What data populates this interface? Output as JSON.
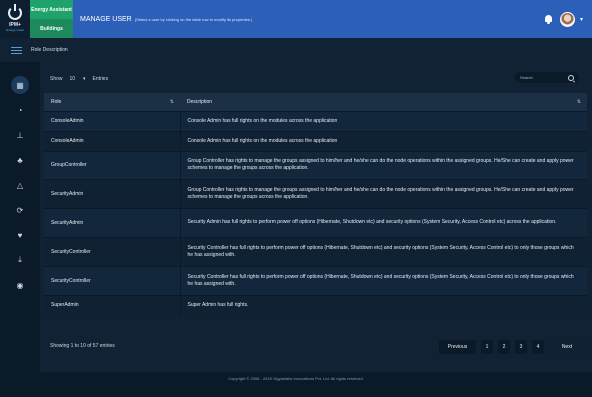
{
  "header": {
    "logo_text": "IPM+",
    "logo_tagline": "Energy smart",
    "app_energy": "Energy Assistant",
    "app_buildings": "Buildings",
    "title": "MANAGE USER",
    "hint": "(Select a user by clicking on the table row to modify its properties.)"
  },
  "subbar": {
    "breadcrumb": "Role Description"
  },
  "sidebar": {
    "items": [
      {
        "icon": "dashboard-icon",
        "active": true
      },
      {
        "icon": "pie-chart-icon"
      },
      {
        "icon": "hierarchy-icon"
      },
      {
        "icon": "devices-icon"
      },
      {
        "icon": "network-icon"
      },
      {
        "icon": "refresh-icon"
      },
      {
        "icon": "heartbeat-icon"
      },
      {
        "icon": "download-icon"
      },
      {
        "icon": "user-icon"
      }
    ]
  },
  "table_controls": {
    "show_label": "Show",
    "page_size": "10",
    "entries_label": "Entries",
    "search_placeholder": "Search"
  },
  "table": {
    "columns": [
      "Role",
      "Description"
    ],
    "rows": [
      {
        "role": "ConsoleAdmin",
        "description": "Console Admin has full rights on the modules across the application"
      },
      {
        "role": "ConsoleAdmin",
        "description": "Console Admin has full rights on the modules across the application"
      },
      {
        "role": "GroupController",
        "description": "Group Controller has rights to manage the groups assigned to him/her and he/she can do the node operations within the assigned groups. He/She can create and apply power schemes to manage the groups across the application."
      },
      {
        "role": "SecurityAdmin",
        "description": "Group Controller has rights to manage the groups assigned to him/her and he/she can do the node operations within the assigned groups. He/She can create and apply power schemes to manage the groups across the application."
      },
      {
        "role": "SecurityAdmin",
        "description": "Security Admin has full rights to perform power off options (Hibernate, Shutdown etc) and security options (System Security, Access Control etc) across the application."
      },
      {
        "role": "SecurityController",
        "description": "Security Controller has full rights to perform power off options (Hibernate, Shutdown etc) and security options (System Security, Access Control etc) to only those groups which he has assigned with."
      },
      {
        "role": "SecurityController",
        "description": "Security Controller has full rights to perform power off options (Hibernate, Shutdown etc) and security options (System Security, Access Control etc) to only those groups which he has assigned with."
      },
      {
        "role": "SuperAdmin",
        "description": "Super Admin has full rights."
      }
    ]
  },
  "footer_info": "Showing 1 to 10 of 57 entries",
  "pagination": {
    "previous": "Previous",
    "pages": [
      "1",
      "2",
      "3",
      "4"
    ],
    "next": "Next"
  },
  "copyright": "Copyright © 2008 - 2019 Vigyanlabs Innovations Pvt. Ltd. All rights reserved."
}
